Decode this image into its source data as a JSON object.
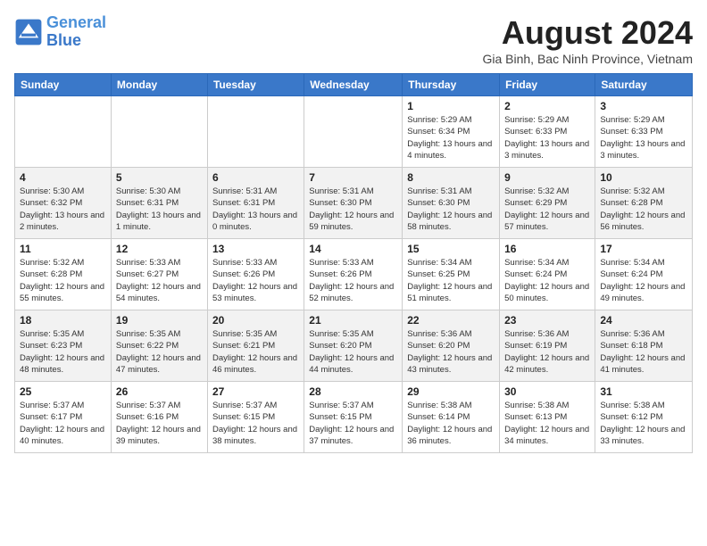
{
  "header": {
    "logo_line1": "General",
    "logo_line2": "Blue",
    "title": "August 2024",
    "subtitle": "Gia Binh, Bac Ninh Province, Vietnam"
  },
  "days_of_week": [
    "Sunday",
    "Monday",
    "Tuesday",
    "Wednesday",
    "Thursday",
    "Friday",
    "Saturday"
  ],
  "weeks": [
    [
      {
        "day": "",
        "info": ""
      },
      {
        "day": "",
        "info": ""
      },
      {
        "day": "",
        "info": ""
      },
      {
        "day": "",
        "info": ""
      },
      {
        "day": "1",
        "info": "Sunrise: 5:29 AM\nSunset: 6:34 PM\nDaylight: 13 hours and 4 minutes."
      },
      {
        "day": "2",
        "info": "Sunrise: 5:29 AM\nSunset: 6:33 PM\nDaylight: 13 hours and 3 minutes."
      },
      {
        "day": "3",
        "info": "Sunrise: 5:29 AM\nSunset: 6:33 PM\nDaylight: 13 hours and 3 minutes."
      }
    ],
    [
      {
        "day": "4",
        "info": "Sunrise: 5:30 AM\nSunset: 6:32 PM\nDaylight: 13 hours and 2 minutes."
      },
      {
        "day": "5",
        "info": "Sunrise: 5:30 AM\nSunset: 6:31 PM\nDaylight: 13 hours and 1 minute."
      },
      {
        "day": "6",
        "info": "Sunrise: 5:31 AM\nSunset: 6:31 PM\nDaylight: 13 hours and 0 minutes."
      },
      {
        "day": "7",
        "info": "Sunrise: 5:31 AM\nSunset: 6:30 PM\nDaylight: 12 hours and 59 minutes."
      },
      {
        "day": "8",
        "info": "Sunrise: 5:31 AM\nSunset: 6:30 PM\nDaylight: 12 hours and 58 minutes."
      },
      {
        "day": "9",
        "info": "Sunrise: 5:32 AM\nSunset: 6:29 PM\nDaylight: 12 hours and 57 minutes."
      },
      {
        "day": "10",
        "info": "Sunrise: 5:32 AM\nSunset: 6:28 PM\nDaylight: 12 hours and 56 minutes."
      }
    ],
    [
      {
        "day": "11",
        "info": "Sunrise: 5:32 AM\nSunset: 6:28 PM\nDaylight: 12 hours and 55 minutes."
      },
      {
        "day": "12",
        "info": "Sunrise: 5:33 AM\nSunset: 6:27 PM\nDaylight: 12 hours and 54 minutes."
      },
      {
        "day": "13",
        "info": "Sunrise: 5:33 AM\nSunset: 6:26 PM\nDaylight: 12 hours and 53 minutes."
      },
      {
        "day": "14",
        "info": "Sunrise: 5:33 AM\nSunset: 6:26 PM\nDaylight: 12 hours and 52 minutes."
      },
      {
        "day": "15",
        "info": "Sunrise: 5:34 AM\nSunset: 6:25 PM\nDaylight: 12 hours and 51 minutes."
      },
      {
        "day": "16",
        "info": "Sunrise: 5:34 AM\nSunset: 6:24 PM\nDaylight: 12 hours and 50 minutes."
      },
      {
        "day": "17",
        "info": "Sunrise: 5:34 AM\nSunset: 6:24 PM\nDaylight: 12 hours and 49 minutes."
      }
    ],
    [
      {
        "day": "18",
        "info": "Sunrise: 5:35 AM\nSunset: 6:23 PM\nDaylight: 12 hours and 48 minutes."
      },
      {
        "day": "19",
        "info": "Sunrise: 5:35 AM\nSunset: 6:22 PM\nDaylight: 12 hours and 47 minutes."
      },
      {
        "day": "20",
        "info": "Sunrise: 5:35 AM\nSunset: 6:21 PM\nDaylight: 12 hours and 46 minutes."
      },
      {
        "day": "21",
        "info": "Sunrise: 5:35 AM\nSunset: 6:20 PM\nDaylight: 12 hours and 44 minutes."
      },
      {
        "day": "22",
        "info": "Sunrise: 5:36 AM\nSunset: 6:20 PM\nDaylight: 12 hours and 43 minutes."
      },
      {
        "day": "23",
        "info": "Sunrise: 5:36 AM\nSunset: 6:19 PM\nDaylight: 12 hours and 42 minutes."
      },
      {
        "day": "24",
        "info": "Sunrise: 5:36 AM\nSunset: 6:18 PM\nDaylight: 12 hours and 41 minutes."
      }
    ],
    [
      {
        "day": "25",
        "info": "Sunrise: 5:37 AM\nSunset: 6:17 PM\nDaylight: 12 hours and 40 minutes."
      },
      {
        "day": "26",
        "info": "Sunrise: 5:37 AM\nSunset: 6:16 PM\nDaylight: 12 hours and 39 minutes."
      },
      {
        "day": "27",
        "info": "Sunrise: 5:37 AM\nSunset: 6:15 PM\nDaylight: 12 hours and 38 minutes."
      },
      {
        "day": "28",
        "info": "Sunrise: 5:37 AM\nSunset: 6:15 PM\nDaylight: 12 hours and 37 minutes."
      },
      {
        "day": "29",
        "info": "Sunrise: 5:38 AM\nSunset: 6:14 PM\nDaylight: 12 hours and 36 minutes."
      },
      {
        "day": "30",
        "info": "Sunrise: 5:38 AM\nSunset: 6:13 PM\nDaylight: 12 hours and 34 minutes."
      },
      {
        "day": "31",
        "info": "Sunrise: 5:38 AM\nSunset: 6:12 PM\nDaylight: 12 hours and 33 minutes."
      }
    ]
  ]
}
